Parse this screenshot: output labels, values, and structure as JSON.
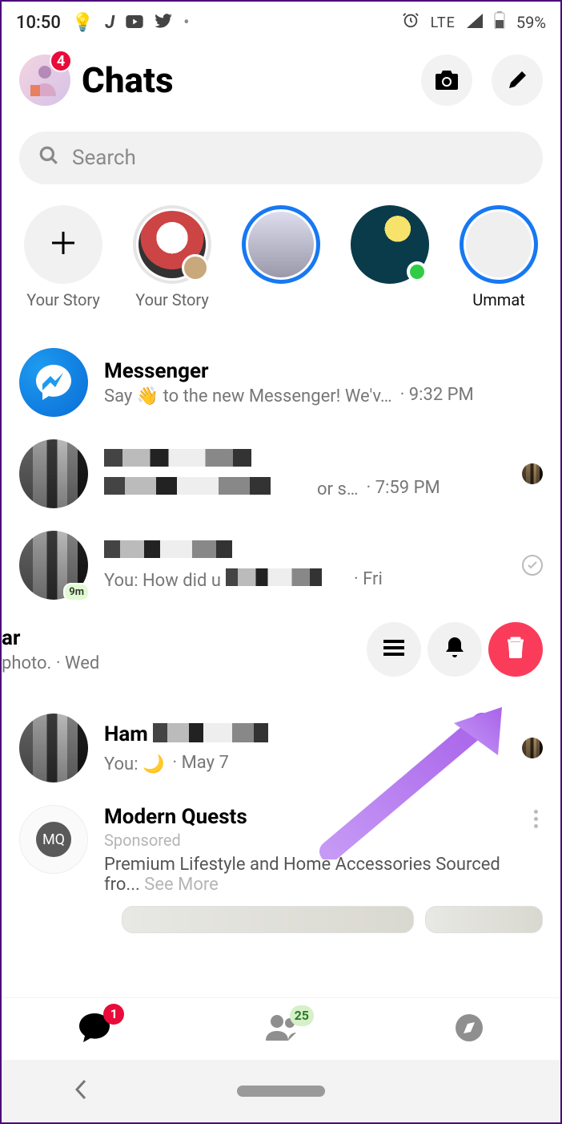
{
  "status": {
    "time": "10:50",
    "network": "LTE",
    "battery": "59%"
  },
  "header": {
    "title": "Chats",
    "badge": "4"
  },
  "search": {
    "placeholder": "Search"
  },
  "stories": {
    "add_label": "Your Story",
    "items": [
      {
        "label": "Your Story"
      },
      {
        "label": ""
      },
      {
        "label": ""
      },
      {
        "label": "Ummat"
      }
    ]
  },
  "chats": [
    {
      "name": "Messenger",
      "msg": "Say 👋 to the new Messenger! We'v…",
      "time": "· 9:32 PM",
      "type": "messenger"
    },
    {
      "name": "",
      "msg_suffix": " or s…",
      "time": "· 7:59 PM",
      "type": "pixelated"
    },
    {
      "name": "",
      "msg_prefix": "You: How did u",
      "time": "· Fri",
      "badge": "9m",
      "type": "pixelated",
      "read_ring": true
    }
  ],
  "swiped": {
    "name_suffix": "ar",
    "sub_prefix": "photo.",
    "sub_time": "· Wed"
  },
  "ham_row": {
    "name": "Ham",
    "msg_prefix": "You: 🌙",
    "msg_time": "· May 7"
  },
  "sponsored": {
    "name": "Modern Quests",
    "tag": "Sponsored",
    "desc": "Premium Lifestyle and Home Accessories Sourced fro... ",
    "see_more": "See More",
    "logo": "MQ"
  },
  "bottom_nav": {
    "chat_badge": "1",
    "people_badge": "25"
  },
  "colors": {
    "accent_blue": "#1778f2",
    "badge_red": "#e80c3a",
    "delete_red": "#fa3c5a",
    "online_green": "#31cc46",
    "arrow_purple": "#b57cf0"
  }
}
